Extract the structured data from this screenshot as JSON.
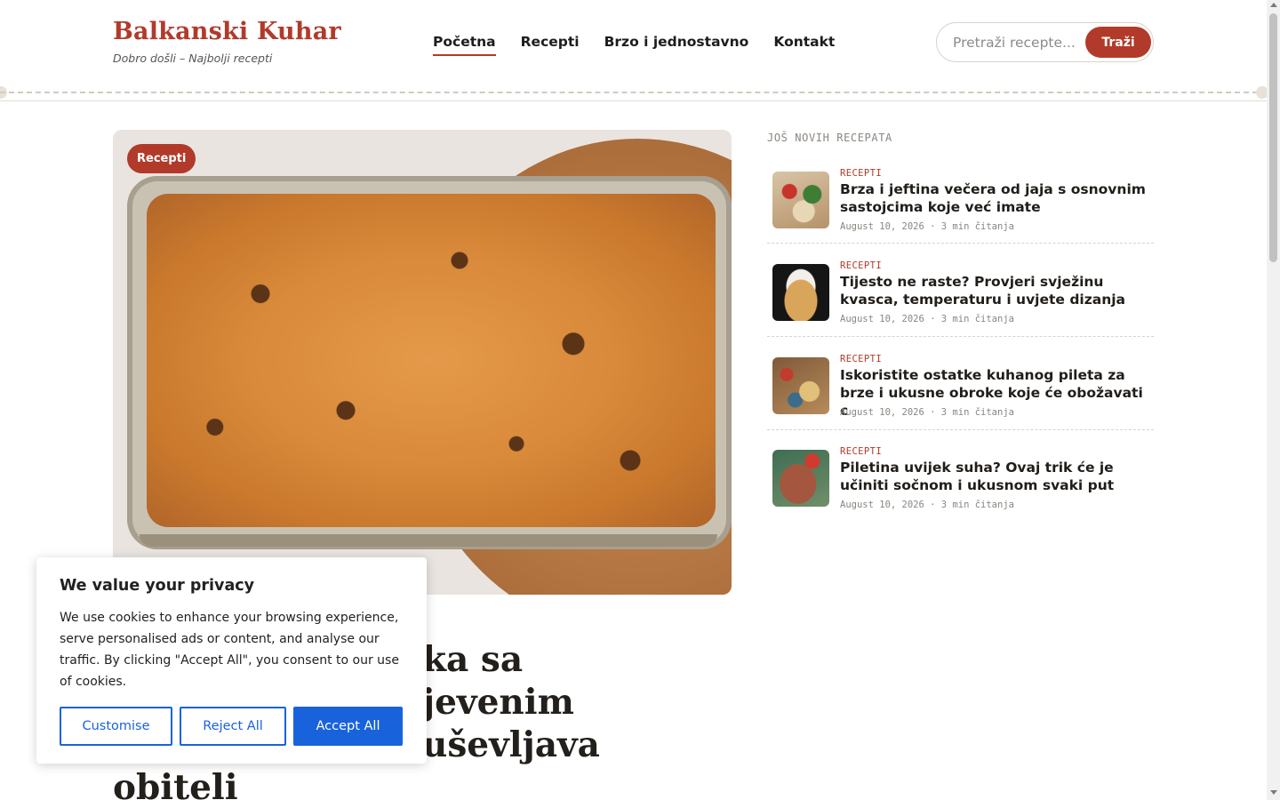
{
  "header": {
    "brand_title": "Balkanski Kuhar",
    "brand_tagline": "Dobro došli – Najbolji recepti",
    "nav": [
      {
        "label": "Početna",
        "active": true
      },
      {
        "label": "Recepti",
        "active": false
      },
      {
        "label": "Brzo i jednostavno",
        "active": false
      },
      {
        "label": "Kontakt",
        "active": false
      }
    ],
    "search": {
      "placeholder": "Pretraži recepte...",
      "value": "",
      "button_label": "Traži"
    }
  },
  "hero": {
    "category_badge": "Recepti",
    "image": "baked-casserole-photo",
    "title_visible": "ka sa\njevenim\nuševljava\nobiteli"
  },
  "sidebar": {
    "heading": "JOŠ NOVIH RECEPATA",
    "posts": [
      {
        "category": "RECEPTI",
        "title": "Brza i jeftina večera od jaja s osnovnim sastojcima koje već imate",
        "meta": "August 10, 2026 · 3 min čitanja"
      },
      {
        "category": "RECEPTI",
        "title": "Tijesto ne raste? Provjeri svježinu kvasca, temperaturu i uvjete dizanja",
        "meta": "August 10, 2026 · 3 min čitanja"
      },
      {
        "category": "RECEPTI",
        "title": "Iskoristite ostatke kuhanog pileta za brze i ukusne obroke koje će obožavati c",
        "meta": "August 10, 2026 · 3 min čitanja"
      },
      {
        "category": "RECEPTI",
        "title": "Piletina uvijek suha? Ovaj trik će je učiniti sočnom i ukusnom svaki put",
        "meta": "August 10, 2026 · 3 min čitanja"
      }
    ]
  },
  "cookie_banner": {
    "title": "We value your privacy",
    "text": "We use cookies to enhance your browsing experience, serve personalised ads or content, and analyse our traffic. By clicking \"Accept All\", you consent to our use of cookies.",
    "buttons": {
      "customise": "Customise",
      "reject": "Reject All",
      "accept": "Accept All"
    }
  },
  "colors": {
    "accent": "#b23a2a",
    "cookie_primary": "#1863dc"
  }
}
